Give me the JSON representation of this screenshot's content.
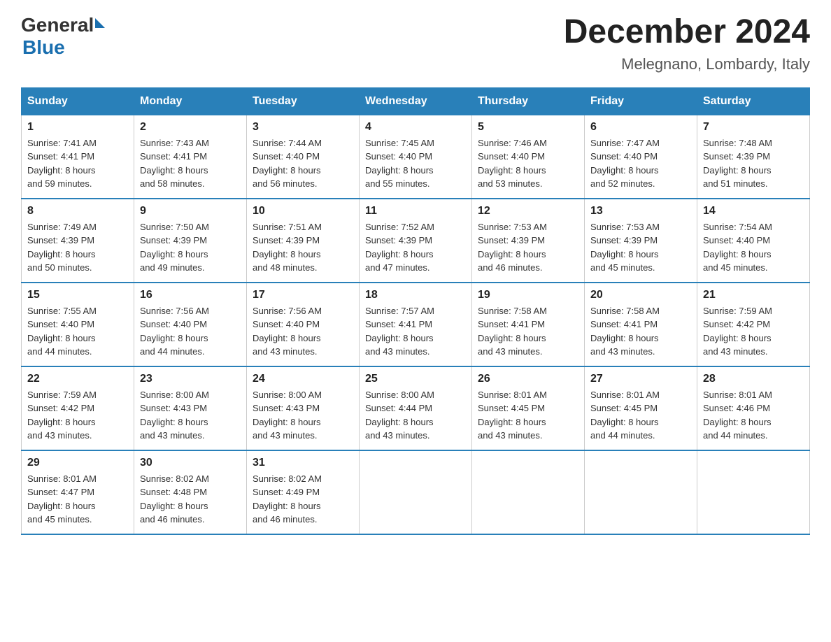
{
  "logo": {
    "general": "General",
    "blue": "Blue"
  },
  "title": {
    "month": "December 2024",
    "location": "Melegnano, Lombardy, Italy"
  },
  "headers": [
    "Sunday",
    "Monday",
    "Tuesday",
    "Wednesday",
    "Thursday",
    "Friday",
    "Saturday"
  ],
  "weeks": [
    [
      {
        "day": "1",
        "sunrise": "7:41 AM",
        "sunset": "4:41 PM",
        "daylight": "8 hours and 59 minutes."
      },
      {
        "day": "2",
        "sunrise": "7:43 AM",
        "sunset": "4:41 PM",
        "daylight": "8 hours and 58 minutes."
      },
      {
        "day": "3",
        "sunrise": "7:44 AM",
        "sunset": "4:40 PM",
        "daylight": "8 hours and 56 minutes."
      },
      {
        "day": "4",
        "sunrise": "7:45 AM",
        "sunset": "4:40 PM",
        "daylight": "8 hours and 55 minutes."
      },
      {
        "day": "5",
        "sunrise": "7:46 AM",
        "sunset": "4:40 PM",
        "daylight": "8 hours and 53 minutes."
      },
      {
        "day": "6",
        "sunrise": "7:47 AM",
        "sunset": "4:40 PM",
        "daylight": "8 hours and 52 minutes."
      },
      {
        "day": "7",
        "sunrise": "7:48 AM",
        "sunset": "4:39 PM",
        "daylight": "8 hours and 51 minutes."
      }
    ],
    [
      {
        "day": "8",
        "sunrise": "7:49 AM",
        "sunset": "4:39 PM",
        "daylight": "8 hours and 50 minutes."
      },
      {
        "day": "9",
        "sunrise": "7:50 AM",
        "sunset": "4:39 PM",
        "daylight": "8 hours and 49 minutes."
      },
      {
        "day": "10",
        "sunrise": "7:51 AM",
        "sunset": "4:39 PM",
        "daylight": "8 hours and 48 minutes."
      },
      {
        "day": "11",
        "sunrise": "7:52 AM",
        "sunset": "4:39 PM",
        "daylight": "8 hours and 47 minutes."
      },
      {
        "day": "12",
        "sunrise": "7:53 AM",
        "sunset": "4:39 PM",
        "daylight": "8 hours and 46 minutes."
      },
      {
        "day": "13",
        "sunrise": "7:53 AM",
        "sunset": "4:39 PM",
        "daylight": "8 hours and 45 minutes."
      },
      {
        "day": "14",
        "sunrise": "7:54 AM",
        "sunset": "4:40 PM",
        "daylight": "8 hours and 45 minutes."
      }
    ],
    [
      {
        "day": "15",
        "sunrise": "7:55 AM",
        "sunset": "4:40 PM",
        "daylight": "8 hours and 44 minutes."
      },
      {
        "day": "16",
        "sunrise": "7:56 AM",
        "sunset": "4:40 PM",
        "daylight": "8 hours and 44 minutes."
      },
      {
        "day": "17",
        "sunrise": "7:56 AM",
        "sunset": "4:40 PM",
        "daylight": "8 hours and 43 minutes."
      },
      {
        "day": "18",
        "sunrise": "7:57 AM",
        "sunset": "4:41 PM",
        "daylight": "8 hours and 43 minutes."
      },
      {
        "day": "19",
        "sunrise": "7:58 AM",
        "sunset": "4:41 PM",
        "daylight": "8 hours and 43 minutes."
      },
      {
        "day": "20",
        "sunrise": "7:58 AM",
        "sunset": "4:41 PM",
        "daylight": "8 hours and 43 minutes."
      },
      {
        "day": "21",
        "sunrise": "7:59 AM",
        "sunset": "4:42 PM",
        "daylight": "8 hours and 43 minutes."
      }
    ],
    [
      {
        "day": "22",
        "sunrise": "7:59 AM",
        "sunset": "4:42 PM",
        "daylight": "8 hours and 43 minutes."
      },
      {
        "day": "23",
        "sunrise": "8:00 AM",
        "sunset": "4:43 PM",
        "daylight": "8 hours and 43 minutes."
      },
      {
        "day": "24",
        "sunrise": "8:00 AM",
        "sunset": "4:43 PM",
        "daylight": "8 hours and 43 minutes."
      },
      {
        "day": "25",
        "sunrise": "8:00 AM",
        "sunset": "4:44 PM",
        "daylight": "8 hours and 43 minutes."
      },
      {
        "day": "26",
        "sunrise": "8:01 AM",
        "sunset": "4:45 PM",
        "daylight": "8 hours and 43 minutes."
      },
      {
        "day": "27",
        "sunrise": "8:01 AM",
        "sunset": "4:45 PM",
        "daylight": "8 hours and 44 minutes."
      },
      {
        "day": "28",
        "sunrise": "8:01 AM",
        "sunset": "4:46 PM",
        "daylight": "8 hours and 44 minutes."
      }
    ],
    [
      {
        "day": "29",
        "sunrise": "8:01 AM",
        "sunset": "4:47 PM",
        "daylight": "8 hours and 45 minutes."
      },
      {
        "day": "30",
        "sunrise": "8:02 AM",
        "sunset": "4:48 PM",
        "daylight": "8 hours and 46 minutes."
      },
      {
        "day": "31",
        "sunrise": "8:02 AM",
        "sunset": "4:49 PM",
        "daylight": "8 hours and 46 minutes."
      },
      null,
      null,
      null,
      null
    ]
  ],
  "labels": {
    "sunrise": "Sunrise:",
    "sunset": "Sunset:",
    "daylight": "Daylight:"
  }
}
